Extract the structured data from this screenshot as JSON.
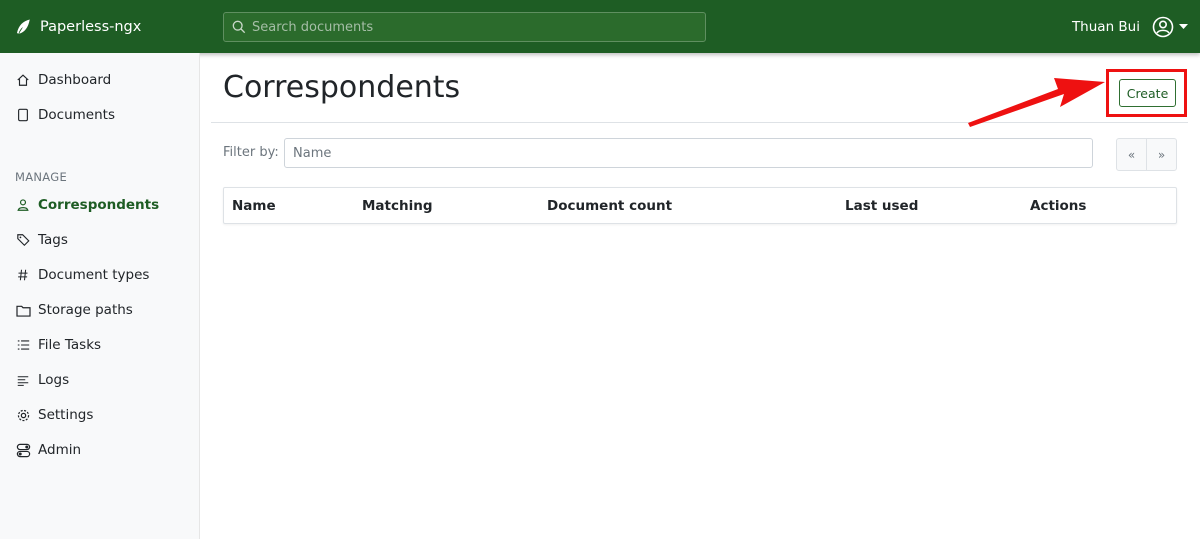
{
  "app": {
    "name": "Paperless-ngx"
  },
  "search": {
    "placeholder": "Search documents"
  },
  "user": {
    "name": "Thuan Bui"
  },
  "sidebar": {
    "top_items": [
      {
        "label": "Dashboard",
        "icon": "house-icon"
      },
      {
        "label": "Documents",
        "icon": "file-icon"
      }
    ],
    "section_label": "MANAGE",
    "manage_items": [
      {
        "label": "Correspondents",
        "icon": "person-icon",
        "active": true
      },
      {
        "label": "Tags",
        "icon": "tags-icon"
      },
      {
        "label": "Document types",
        "icon": "hash-icon"
      },
      {
        "label": "Storage paths",
        "icon": "folder-icon"
      },
      {
        "label": "File Tasks",
        "icon": "list-task-icon"
      },
      {
        "label": "Logs",
        "icon": "text-left-icon"
      },
      {
        "label": "Settings",
        "icon": "gear-icon"
      },
      {
        "label": "Admin",
        "icon": "toggles-icon"
      }
    ]
  },
  "main": {
    "title": "Correspondents",
    "create_label": "Create",
    "filter_label": "Filter by:",
    "filter_placeholder": "Name",
    "pager": {
      "first": "«",
      "last": "»"
    },
    "table": {
      "columns": [
        "Name",
        "Matching",
        "Document count",
        "Last used",
        "Actions"
      ]
    }
  },
  "colors": {
    "brand_green": "#1e5d24",
    "annotation_red": "#ee1111"
  }
}
